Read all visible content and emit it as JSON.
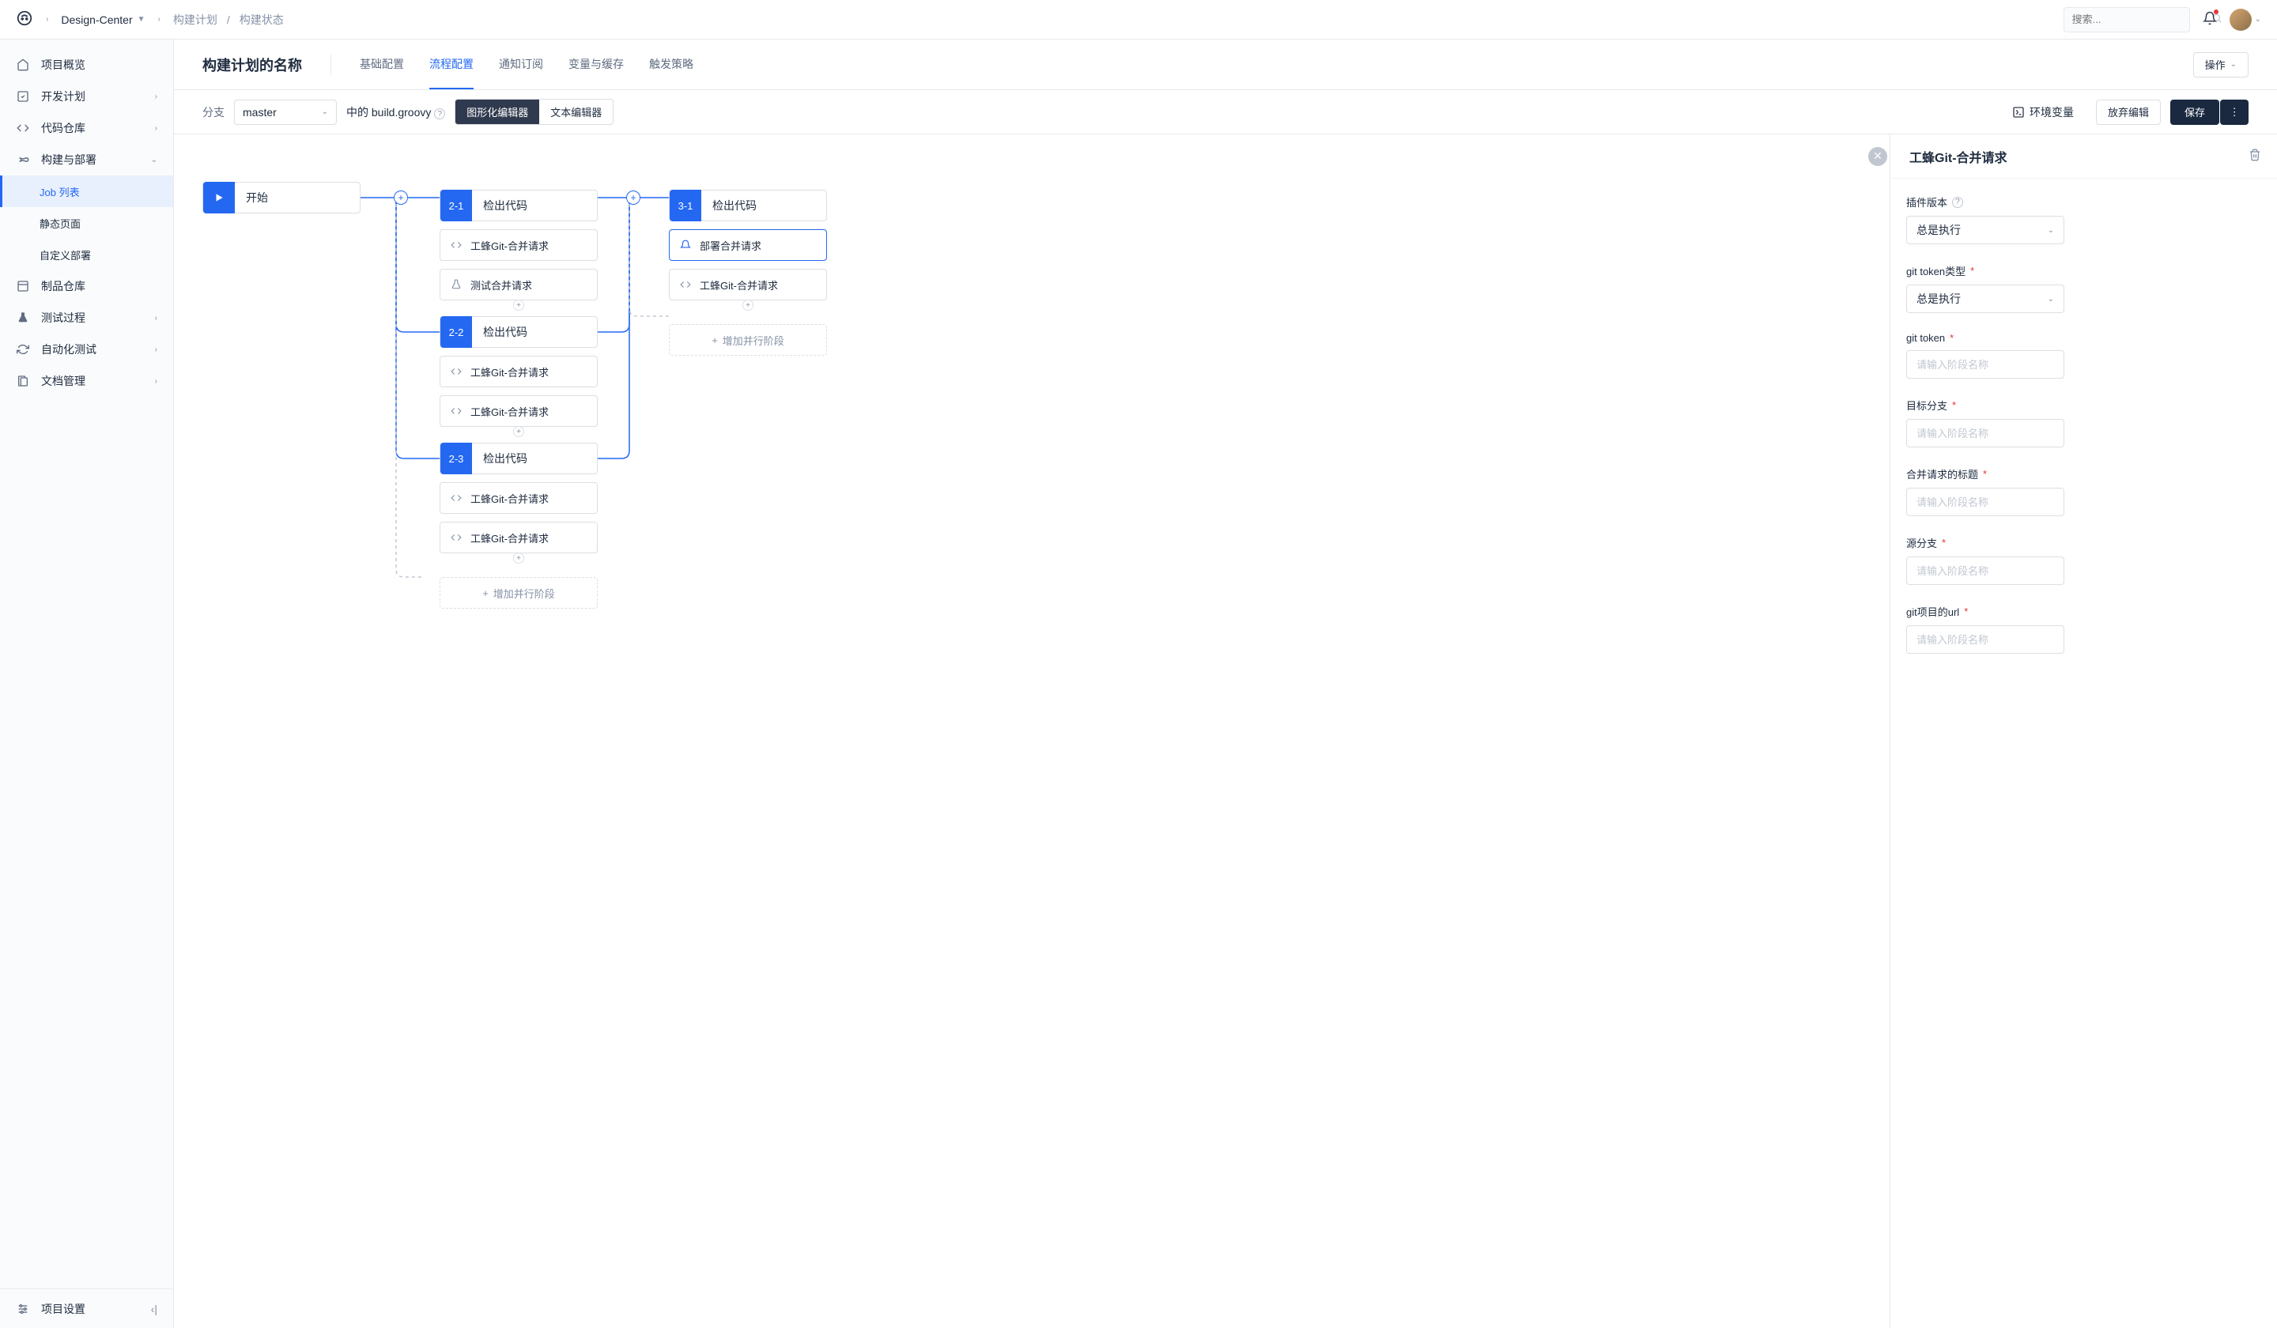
{
  "header": {
    "project": "Design-Center",
    "breadcrumb": [
      "构建计划",
      "构建状态"
    ],
    "search_placeholder": "搜索..."
  },
  "sidebar": {
    "items": [
      {
        "label": "项目概览",
        "icon": "home"
      },
      {
        "label": "开发计划",
        "icon": "check",
        "expandable": true
      },
      {
        "label": "代码仓库",
        "icon": "code",
        "expandable": true
      },
      {
        "label": "构建与部署",
        "icon": "infinity",
        "expanded": true,
        "children": [
          {
            "label": "Job 列表",
            "active": true
          },
          {
            "label": "静态页面"
          },
          {
            "label": "自定义部署"
          }
        ]
      },
      {
        "label": "制品仓库",
        "icon": "box"
      },
      {
        "label": "测试过程",
        "icon": "flask",
        "expandable": true
      },
      {
        "label": "自动化测试",
        "icon": "refresh",
        "expandable": true
      },
      {
        "label": "文档管理",
        "icon": "doc",
        "expandable": true
      }
    ],
    "footer": "项目设置"
  },
  "page": {
    "title": "构建计划的名称",
    "tabs": [
      "基础配置",
      "流程配置",
      "通知订阅",
      "变量与缓存",
      "触发策略"
    ],
    "active_tab": 1,
    "action_btn": "操作"
  },
  "toolbar": {
    "branch_label": "分支",
    "branch_value": "master",
    "file_text": "中的 build.groovy",
    "editor_visual": "图形化编辑器",
    "editor_text": "文本编辑器",
    "env_vars": "环境变量",
    "discard": "放弃编辑",
    "save": "保存"
  },
  "pipeline": {
    "start_label": "开始",
    "stages": [
      {
        "badge": "2-1",
        "title": "检出代码",
        "steps": [
          {
            "icon": "code",
            "label": "工蜂Git-合并请求"
          },
          {
            "icon": "flask",
            "label": "测试合并请求"
          }
        ]
      },
      {
        "badge": "2-2",
        "title": "检出代码",
        "steps": [
          {
            "icon": "code",
            "label": "工蜂Git-合并请求"
          },
          {
            "icon": "code",
            "label": "工蜂Git-合并请求"
          }
        ]
      },
      {
        "badge": "2-3",
        "title": "检出代码",
        "steps": [
          {
            "icon": "code",
            "label": "工蜂Git-合并请求"
          },
          {
            "icon": "code",
            "label": "工蜂Git-合并请求"
          }
        ]
      }
    ],
    "col3": {
      "badge": "3-1",
      "title": "检出代码",
      "steps": [
        {
          "icon": "bell",
          "label": "部署合并请求"
        },
        {
          "icon": "code",
          "label": "工蜂Git-合并请求"
        }
      ]
    },
    "add_parallel": "增加并行阶段"
  },
  "panel": {
    "title": "工蜂Git-合并请求",
    "fields": [
      {
        "label": "插件版本",
        "type": "select",
        "value": "总是执行",
        "help": true
      },
      {
        "label": "git token类型",
        "type": "select",
        "value": "总是执行",
        "required": true
      },
      {
        "label": "git token",
        "type": "input",
        "placeholder": "请输入阶段名称",
        "required": true
      },
      {
        "label": "目标分支",
        "type": "input",
        "placeholder": "请输入阶段名称",
        "required": true
      },
      {
        "label": "合并请求的标题",
        "type": "input",
        "placeholder": "请输入阶段名称",
        "required": true
      },
      {
        "label": "源分支",
        "type": "input",
        "placeholder": "请输入阶段名称",
        "required": true
      },
      {
        "label": "git项目的url",
        "type": "input",
        "placeholder": "请输入阶段名称",
        "required": true
      }
    ]
  }
}
